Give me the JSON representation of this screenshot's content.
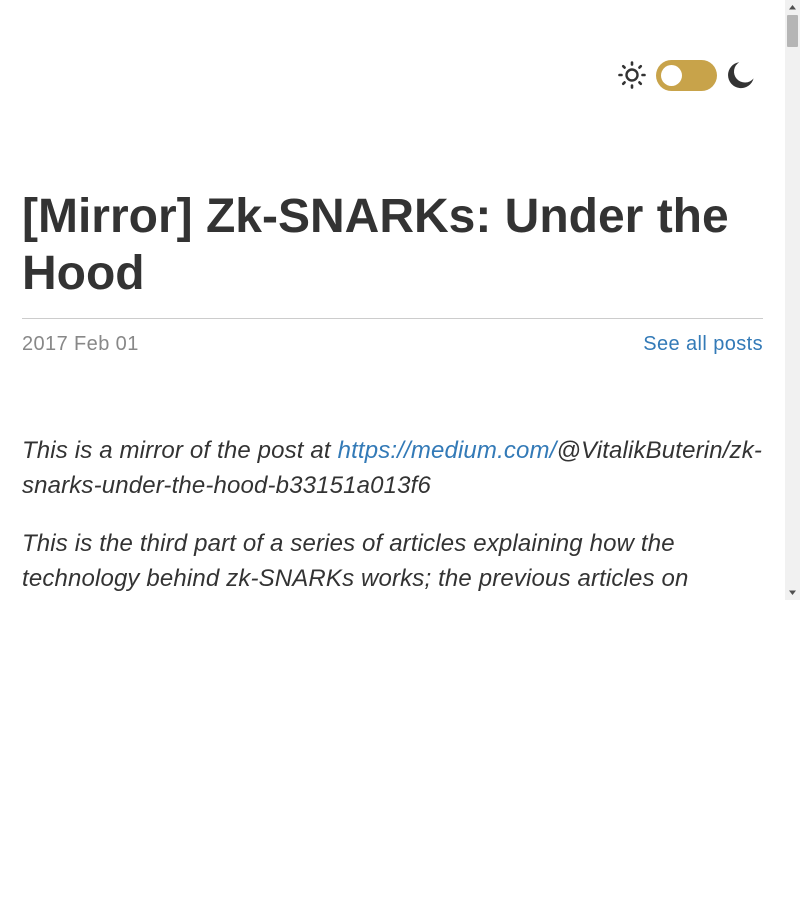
{
  "theme_toggle": {
    "light_icon": "sun-icon",
    "dark_icon": "moon-icon",
    "mode": "light",
    "track_color": "#c8a34a"
  },
  "post": {
    "title": "[Mirror] Zk-SNARKs: Under the Hood",
    "date": "2017 Feb 01",
    "see_all_label": "See all posts",
    "paragraphs": [
      {
        "prefix": "This is a mirror of the post at ",
        "link_text": "https://medium.com/",
        "suffix": "@VitalikButerin/zk-snarks-under-the-hood-b33151a013f6"
      },
      {
        "text": "This is the third part of a series of articles explaining how the technology behind zk-SNARKs works; the previous articles on"
      }
    ]
  },
  "colors": {
    "text": "#333333",
    "muted": "#888888",
    "link": "#337ab7",
    "divider": "#cccccc"
  }
}
